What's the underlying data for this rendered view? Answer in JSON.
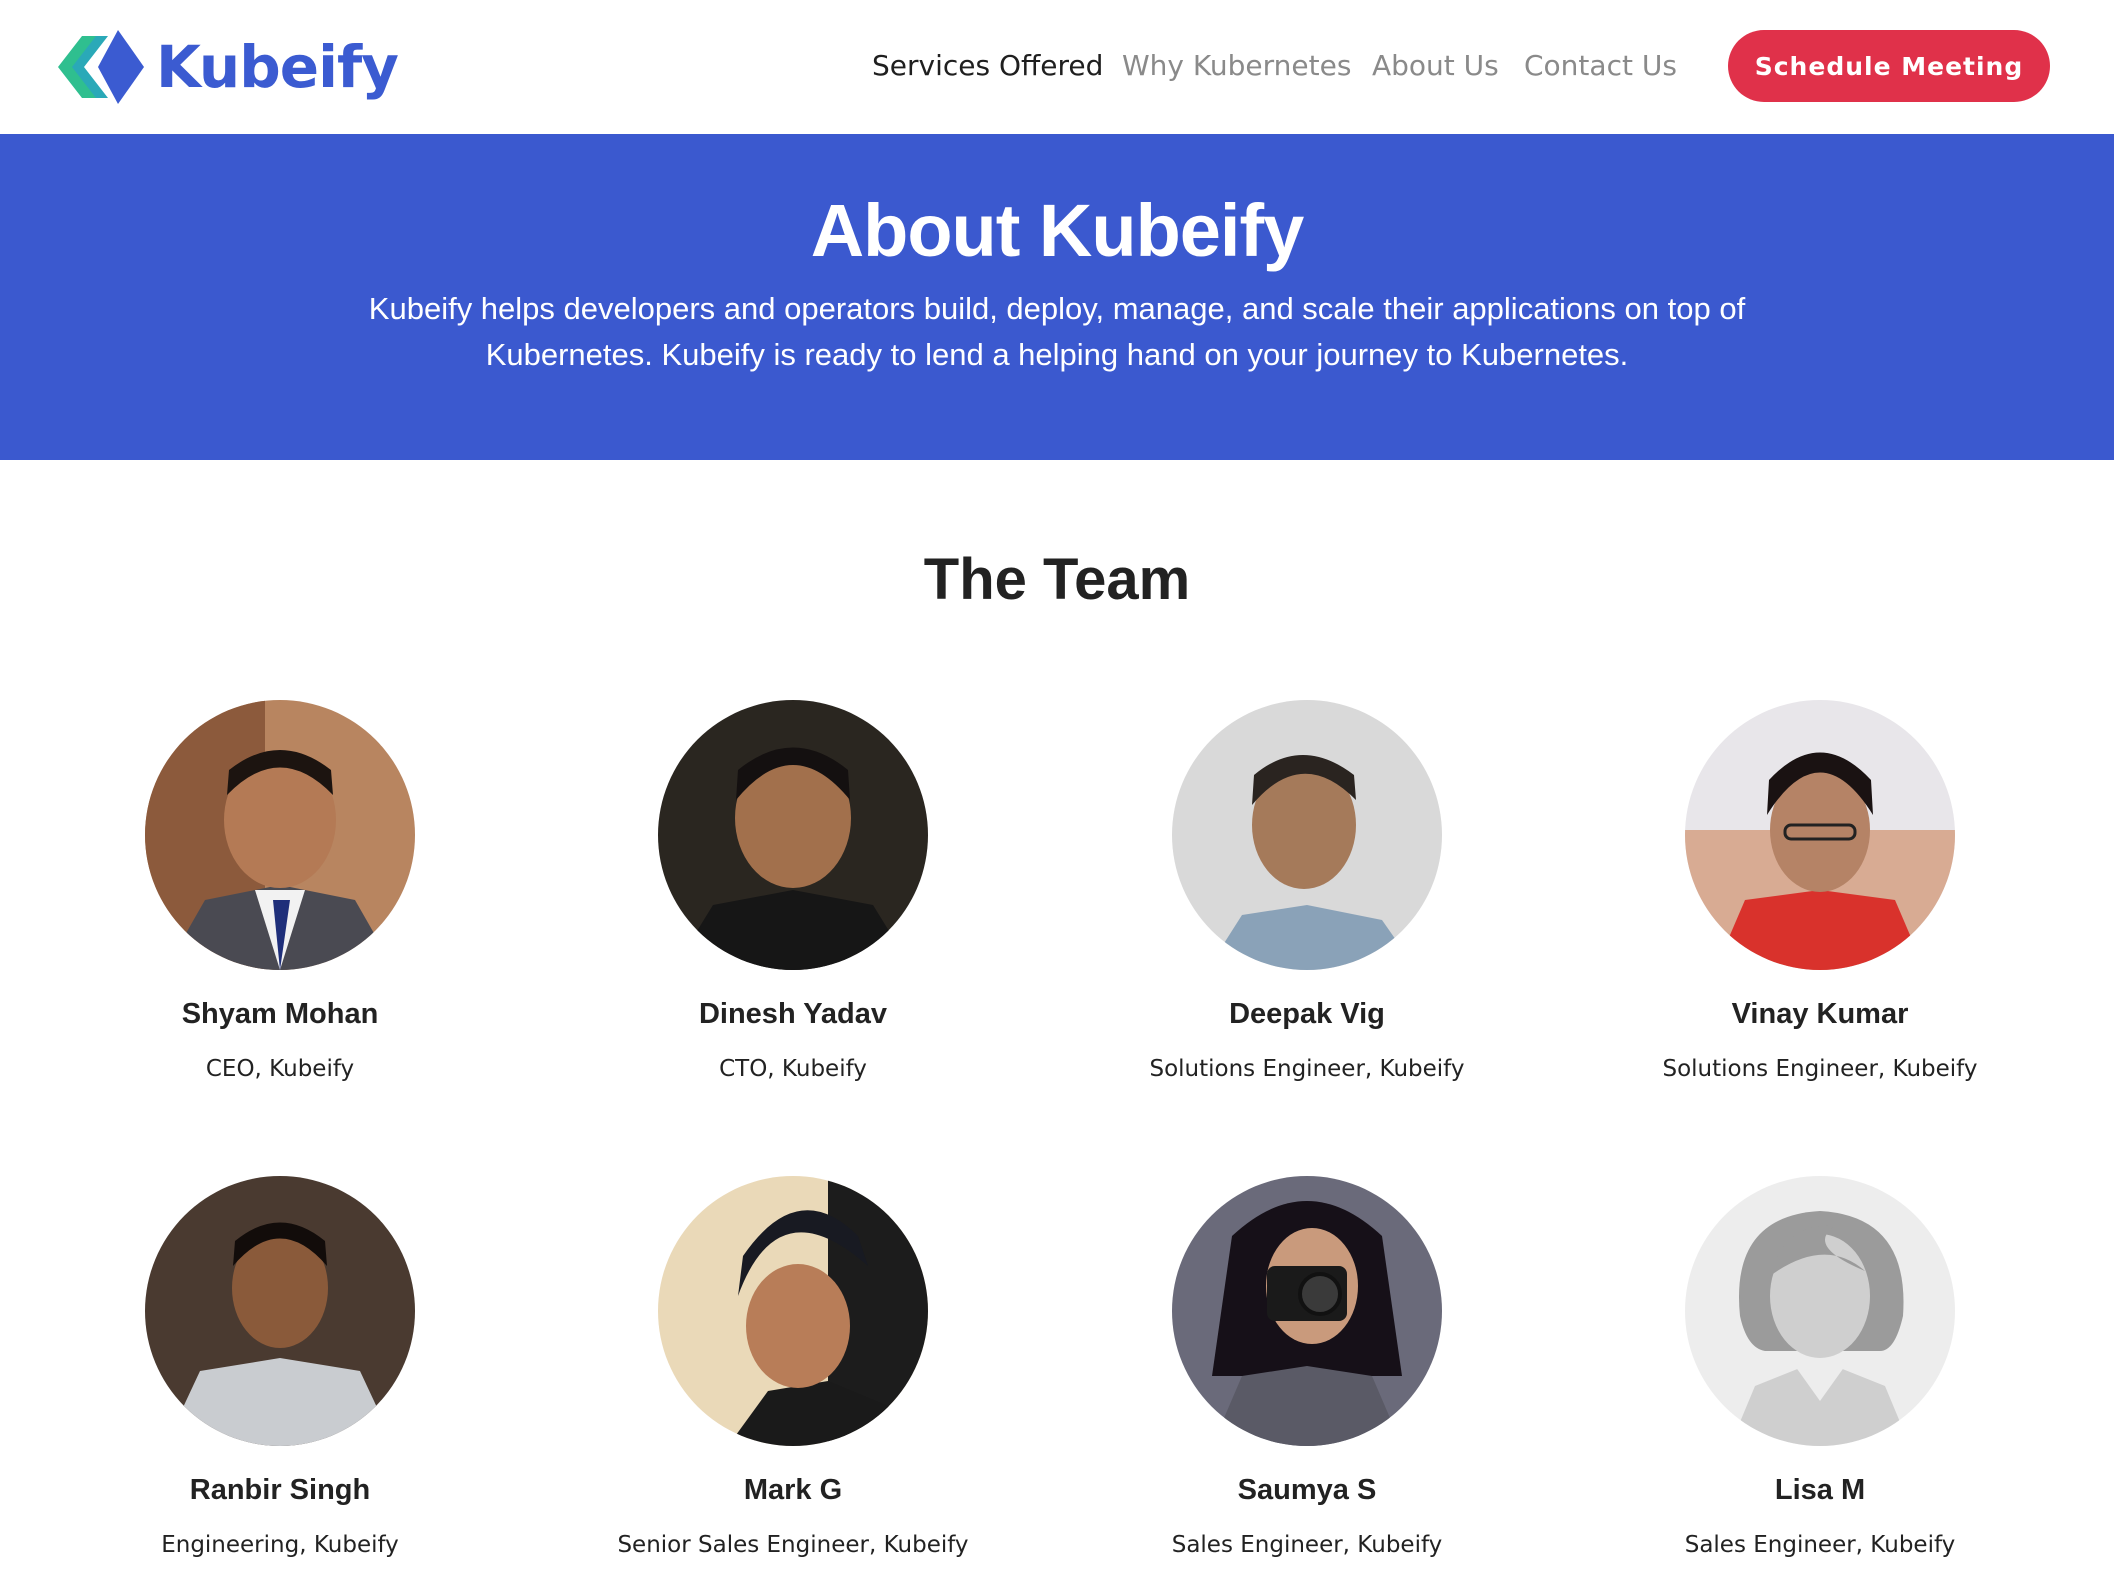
{
  "brand": {
    "name": "Kubeify",
    "logo": "kubeify-logo-icon"
  },
  "nav": {
    "items": [
      {
        "label": "Services Offered",
        "active": true
      },
      {
        "label": "Why Kubernetes",
        "active": false
      },
      {
        "label": "About Us",
        "active": false
      },
      {
        "label": "Contact Us",
        "active": false
      }
    ],
    "cta_label": "Schedule Meeting"
  },
  "hero": {
    "title": "About Kubeify",
    "text": "Kubeify helps developers and operators build, deploy, manage, and scale their applications on top of Kubernetes. Kubeify is ready to lend a helping hand on your journey to Kubernetes."
  },
  "team": {
    "title": "The Team",
    "members": [
      {
        "name": "Shyam Mohan",
        "role": "CEO, Kubeify"
      },
      {
        "name": "Dinesh Yadav",
        "role": "CTO, Kubeify"
      },
      {
        "name": "Deepak Vig",
        "role": "Solutions Engineer, Kubeify"
      },
      {
        "name": "Vinay Kumar",
        "role": "Solutions Engineer, Kubeify"
      },
      {
        "name": "Ranbir Singh",
        "role": "Engineering, Kubeify"
      },
      {
        "name": "Mark G",
        "role": "Senior Sales Engineer, Kubeify"
      },
      {
        "name": "Saumya S",
        "role": "Sales Engineer, Kubeify"
      },
      {
        "name": "Lisa M",
        "role": "Sales Engineer, Kubeify"
      }
    ]
  },
  "colors": {
    "brand_blue": "#3b5bd1",
    "hero_blue": "#3b59cf",
    "cta_red": "#e0314a",
    "logo_green": "#2fbf8f"
  }
}
